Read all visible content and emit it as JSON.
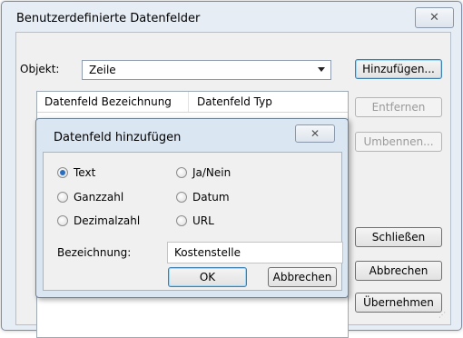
{
  "window": {
    "title": "Benutzerdefinierte Datenfelder",
    "close_glyph": "✕"
  },
  "object_row": {
    "label": "Objekt:",
    "selected": "Zeile"
  },
  "buttons": {
    "add": "Hinzufügen...",
    "remove": "Entfernen",
    "rename": "Umbennen...",
    "close": "Schließen",
    "cancel": "Abbrechen",
    "apply": "Übernehmen"
  },
  "list": {
    "columns": [
      "Datenfeld Bezeichnung",
      "Datenfeld Typ"
    ]
  },
  "dialog": {
    "title": "Datenfeld hinzufügen",
    "close_glyph": "✕",
    "radios": [
      {
        "label": "Text",
        "checked": true
      },
      {
        "label": "Ja/Nein",
        "checked": false
      },
      {
        "label": "Ganzzahl",
        "checked": false
      },
      {
        "label": "Datum",
        "checked": false
      },
      {
        "label": "Dezimalzahl",
        "checked": false
      },
      {
        "label": "URL",
        "checked": false
      }
    ],
    "name_label": "Bezeichnung:",
    "name_value": "Kostenstelle",
    "ok": "OK",
    "cancel": "Abbrechen"
  }
}
